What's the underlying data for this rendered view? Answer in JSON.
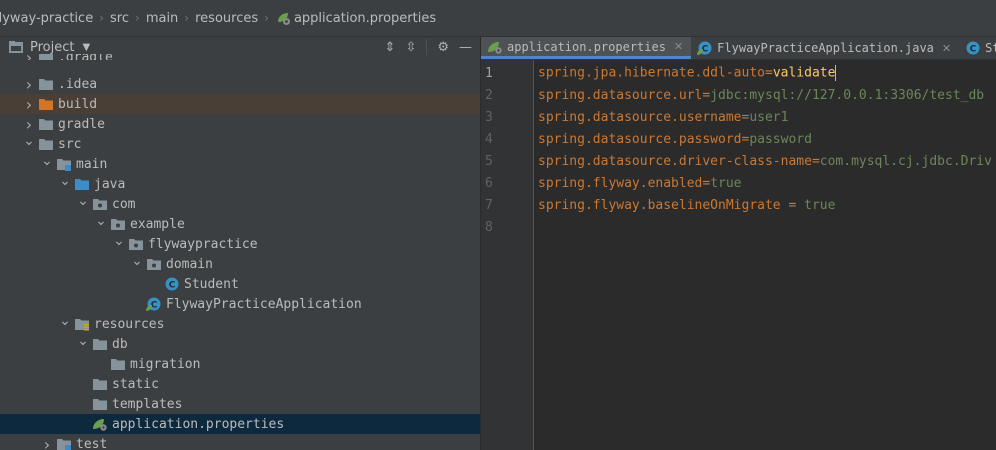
{
  "breadcrumb": {
    "items": [
      "flyway-practice",
      "src",
      "main",
      "resources",
      "application.properties"
    ]
  },
  "sidebar": {
    "title": "Project",
    "tree": [
      {
        "label": ".gradle",
        "depth": 1,
        "arrow": "right",
        "icon": "folder",
        "partial": true
      },
      {
        "label": ".idea",
        "depth": 1,
        "arrow": "right",
        "icon": "folder"
      },
      {
        "label": "build",
        "depth": 1,
        "arrow": "right",
        "icon": "folder-excluded",
        "excluded": true
      },
      {
        "label": "gradle",
        "depth": 1,
        "arrow": "right",
        "icon": "folder"
      },
      {
        "label": "src",
        "depth": 1,
        "arrow": "down",
        "icon": "folder"
      },
      {
        "label": "main",
        "depth": 2,
        "arrow": "down",
        "icon": "folder-module"
      },
      {
        "label": "java",
        "depth": 3,
        "arrow": "down",
        "icon": "folder-source"
      },
      {
        "label": "com",
        "depth": 4,
        "arrow": "down",
        "icon": "package"
      },
      {
        "label": "example",
        "depth": 5,
        "arrow": "down",
        "icon": "package"
      },
      {
        "label": "flywaypractice",
        "depth": 6,
        "arrow": "down",
        "icon": "package"
      },
      {
        "label": "domain",
        "depth": 7,
        "arrow": "down",
        "icon": "package"
      },
      {
        "label": "Student",
        "depth": 8,
        "arrow": "none",
        "icon": "class"
      },
      {
        "label": "FlywayPracticeApplication",
        "depth": 7,
        "arrow": "none",
        "icon": "spring-class"
      },
      {
        "label": "resources",
        "depth": 3,
        "arrow": "down",
        "icon": "folder-resources"
      },
      {
        "label": "db",
        "depth": 4,
        "arrow": "down",
        "icon": "folder"
      },
      {
        "label": "migration",
        "depth": 5,
        "arrow": "none",
        "icon": "folder"
      },
      {
        "label": "static",
        "depth": 4,
        "arrow": "none",
        "icon": "folder"
      },
      {
        "label": "templates",
        "depth": 4,
        "arrow": "none",
        "icon": "folder"
      },
      {
        "label": "application.properties",
        "depth": 4,
        "arrow": "none",
        "icon": "spring-properties",
        "selected": true
      },
      {
        "label": "test",
        "depth": 2,
        "arrow": "right",
        "icon": "folder-module"
      }
    ]
  },
  "editor": {
    "tabs": [
      {
        "label": "application.properties",
        "active": true,
        "icon": "spring-properties"
      },
      {
        "label": "FlywayPracticeApplication.java",
        "active": false,
        "icon": "spring-class"
      },
      {
        "label": "Student",
        "active": false,
        "icon": "class"
      }
    ],
    "lines": [
      {
        "n": "1",
        "key": "spring.jpa.hibernate.ddl-auto",
        "sep": "=",
        "value": "validate",
        "current": true
      },
      {
        "n": "2",
        "key": "spring.datasource.url",
        "sep": "=",
        "value": "jdbc:mysql://127.0.0.1:3306/test_db"
      },
      {
        "n": "3",
        "key": "spring.datasource.username",
        "sep": "=",
        "value": "user1"
      },
      {
        "n": "4",
        "key": "spring.datasource.password",
        "sep": "=",
        "value": "password"
      },
      {
        "n": "5",
        "key": "spring.datasource.driver-class-name",
        "sep": "=",
        "value": "com.mysql.cj.jdbc.Driv"
      },
      {
        "n": "6",
        "key": "spring.flyway.enabled",
        "sep": "=",
        "value": "true"
      },
      {
        "n": "7",
        "key": "spring.flyway.baselineOnMigrate",
        "sep": " = ",
        "value": "true"
      },
      {
        "n": "8",
        "key": "",
        "sep": "",
        "value": ""
      }
    ]
  },
  "colors": {
    "key": "#cc7832",
    "value": "#6a8759",
    "selection": "#0d293e",
    "excluded": "#4a3f37",
    "accent": "#4a88c7"
  }
}
